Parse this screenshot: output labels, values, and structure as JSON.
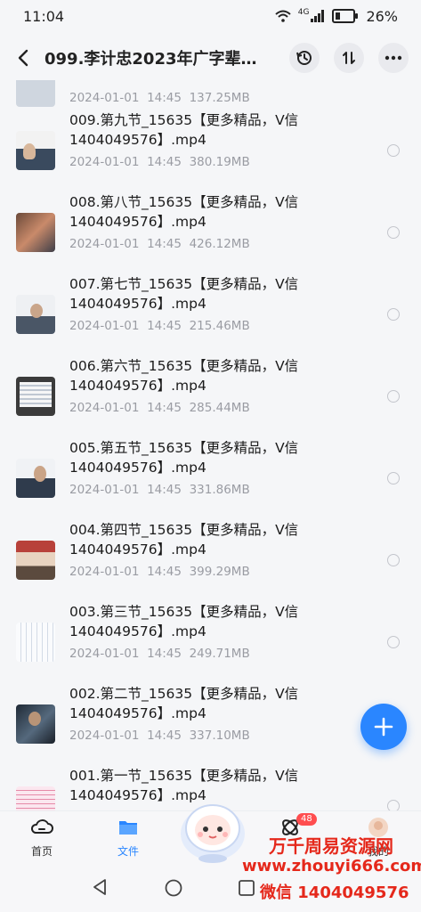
{
  "status": {
    "time": "11:04",
    "signal": "4G",
    "battery": "26%"
  },
  "header": {
    "title": "099.李计忠2023年广字辈一…"
  },
  "partial_row": {
    "date": "2024-01-01",
    "time": "14:45",
    "size": "137.25MB"
  },
  "files": [
    {
      "name": "009.第九节_15635【更多精品，V信\n1404049576】.mp4",
      "date": "2024-01-01",
      "time": "14:45",
      "size": "380.19MB",
      "thumb": "classroom"
    },
    {
      "name": "008.第八节_15635【更多精品，V信\n1404049576】.mp4",
      "date": "2024-01-01",
      "time": "14:45",
      "size": "426.12MB",
      "thumb": "crowd"
    },
    {
      "name": "007.第七节_15635【更多精品，V信\n1404049576】.mp4",
      "date": "2024-01-01",
      "time": "14:45",
      "size": "215.46MB",
      "thumb": "speaker"
    },
    {
      "name": "006.第六节_15635【更多精品，V信\n1404049576】.mp4",
      "date": "2024-01-01",
      "time": "14:45",
      "size": "285.44MB",
      "thumb": "slide"
    },
    {
      "name": "005.第五节_15635【更多精品，V信\n1404049576】.mp4",
      "date": "2024-01-01",
      "time": "14:45",
      "size": "331.86MB",
      "thumb": "speaker"
    },
    {
      "name": "004.第四节_15635【更多精品，V信\n1404049576】.mp4",
      "date": "2024-01-01",
      "time": "14:45",
      "size": "399.29MB",
      "thumb": "crowd"
    },
    {
      "name": "003.第三节_15635【更多精品，V信\n1404049576】.mp4",
      "date": "2024-01-01",
      "time": "14:45",
      "size": "249.71MB",
      "thumb": "board"
    },
    {
      "name": "002.第二节_15635【更多精品，V信\n1404049576】.mp4",
      "date": "2024-01-01",
      "time": "14:45",
      "size": "337.10MB",
      "thumb": "dark"
    },
    {
      "name": "001.第一节_15635【更多精品，V信\n1404049576】.mp4",
      "date": "",
      "time": "",
      "size": "",
      "thumb": "slide-pink"
    }
  ],
  "nav": {
    "home": "首页",
    "files": "文件",
    "share_badge": "48",
    "mine": "我的"
  },
  "watermark": {
    "line1": "万千周易资源网",
    "line2": "www.zhouyi666.com",
    "line3": "微信 1404049576"
  },
  "colors": {
    "accent": "#2a86ff",
    "badge": "#ff4d4f",
    "watermark": "#e5281b"
  },
  "icons": [
    "back-icon",
    "history-icon",
    "sort-icon",
    "more-icon",
    "add-icon",
    "home-icon",
    "folder-icon",
    "share-icon"
  ]
}
